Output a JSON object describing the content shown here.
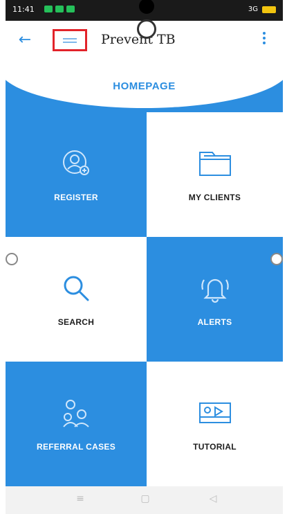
{
  "status_bar": {
    "time": "11:41",
    "right_text": "3G"
  },
  "app_bar": {
    "title": "Prevent TB",
    "back_icon": "arrow-left-icon",
    "menu_icon": "hamburger-icon",
    "overflow_icon": "more-vert-icon"
  },
  "header": {
    "label": "HOMEPAGE"
  },
  "tiles": [
    {
      "label": "REGISTER",
      "icon": "register-user-icon",
      "style": "blue"
    },
    {
      "label": "MY CLIENTS",
      "icon": "folder-icon",
      "style": "white"
    },
    {
      "label": "SEARCH",
      "icon": "search-icon",
      "style": "white"
    },
    {
      "label": "ALERTS",
      "icon": "bell-icon",
      "style": "blue"
    },
    {
      "label": "REFERRAL CASES",
      "icon": "group-icon",
      "style": "blue"
    },
    {
      "label": "TUTORIAL",
      "icon": "video-tutorial-icon",
      "style": "white"
    }
  ],
  "colors": {
    "primary": "#2c8ee0",
    "highlight_box": "#e2232a"
  }
}
